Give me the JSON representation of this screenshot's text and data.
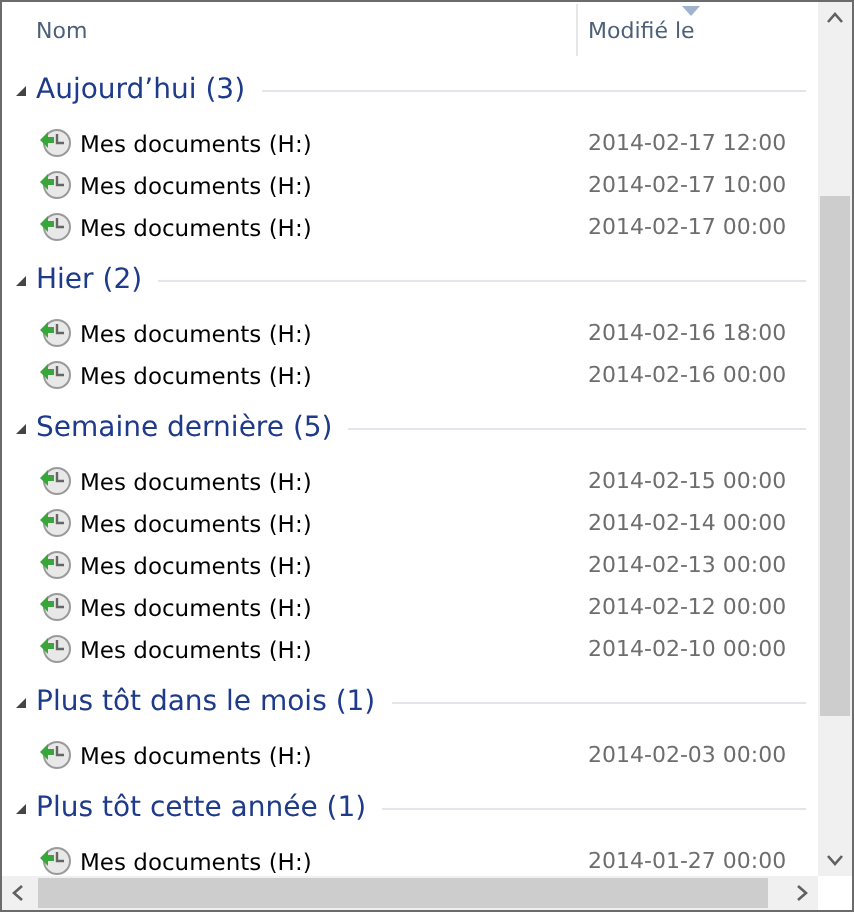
{
  "columns": [
    {
      "label": "Nom",
      "sorted": false
    },
    {
      "label": "Modifié le",
      "sorted": true
    }
  ],
  "groups": [
    {
      "title": "Aujourd’hui (3)",
      "expanded": true,
      "items": [
        {
          "name": "Mes documents (H:)",
          "modified": "2014-02-17 12:00"
        },
        {
          "name": "Mes documents (H:)",
          "modified": "2014-02-17 10:00"
        },
        {
          "name": "Mes documents (H:)",
          "modified": "2014-02-17 00:00"
        }
      ]
    },
    {
      "title": "Hier (2)",
      "expanded": true,
      "items": [
        {
          "name": "Mes documents (H:)",
          "modified": "2014-02-16 18:00"
        },
        {
          "name": "Mes documents (H:)",
          "modified": "2014-02-16 00:00"
        }
      ]
    },
    {
      "title": "Semaine dernière (5)",
      "expanded": true,
      "items": [
        {
          "name": "Mes documents (H:)",
          "modified": "2014-02-15 00:00"
        },
        {
          "name": "Mes documents (H:)",
          "modified": "2014-02-14 00:00"
        },
        {
          "name": "Mes documents (H:)",
          "modified": "2014-02-13 00:00"
        },
        {
          "name": "Mes documents (H:)",
          "modified": "2014-02-12 00:00"
        },
        {
          "name": "Mes documents (H:)",
          "modified": "2014-02-10 00:00"
        }
      ]
    },
    {
      "title": "Plus tôt dans le mois (1)",
      "expanded": true,
      "items": [
        {
          "name": "Mes documents (H:)",
          "modified": "2014-02-03 00:00"
        }
      ]
    },
    {
      "title": "Plus tôt cette année (1)",
      "expanded": true,
      "items": [
        {
          "name": "Mes documents (H:)",
          "modified": "2014-01-27 00:00"
        }
      ]
    }
  ]
}
